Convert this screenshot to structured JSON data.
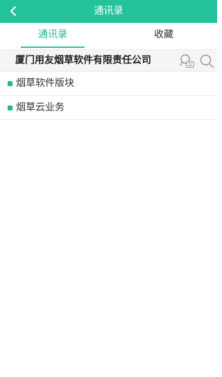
{
  "header": {
    "title": "通讯录",
    "back_icon": "chevron-left-icon"
  },
  "tabs": [
    {
      "label": "通讯录",
      "active": true
    },
    {
      "label": "收藏",
      "active": false
    }
  ],
  "organization": {
    "name": "厦门用友烟草软件有限责任公司",
    "icons": [
      "contact-card-search-icon",
      "search-icon"
    ]
  },
  "departments": [
    {
      "label": "烟草软件版块"
    },
    {
      "label": "烟草云业务"
    }
  ],
  "colors": {
    "accent": "#25c39c",
    "accent_text": "#25b592",
    "row_background": "#f5f5f5"
  }
}
